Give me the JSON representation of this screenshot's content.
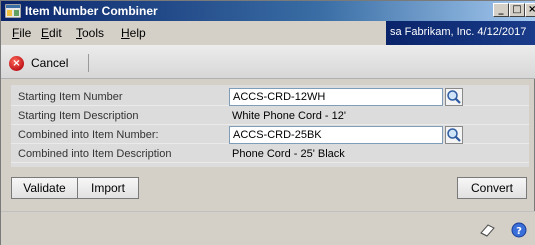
{
  "window": {
    "title": "Item Number Combiner"
  },
  "menu": {
    "file": {
      "accel": "F",
      "rest": "ile"
    },
    "edit": {
      "accel": "E",
      "rest": "dit"
    },
    "tools": {
      "accel": "T",
      "rest": "ools"
    },
    "help": {
      "accel": "H",
      "rest": "elp"
    }
  },
  "user_info": "sa  Fabrikam, Inc.  4/12/2017",
  "toolbar": {
    "cancel_label": "Cancel"
  },
  "form": {
    "starting_item_number": {
      "label": "Starting Item Number",
      "value": "ACCS-CRD-12WH"
    },
    "starting_item_description": {
      "label": "Starting Item Description",
      "value": "White Phone Cord - 12'"
    },
    "combined_item_number": {
      "label": "Combined into Item Number:",
      "value": "ACCS-CRD-25BK"
    },
    "combined_item_description": {
      "label": "Combined into Item Description",
      "value": "Phone Cord - 25' Black"
    }
  },
  "buttons": {
    "validate": "Validate",
    "import": "Import",
    "convert": "Convert"
  },
  "icons": {
    "app": "window-app-icon",
    "lookup": "magnifier-lookup-icon",
    "cancel": "cancel-x-icon",
    "note": "note-icon",
    "help": "help-icon"
  },
  "colors": {
    "titlebar": "#0a246a",
    "cancel_red": "#c0141a",
    "field_border": "#7f9db9"
  }
}
